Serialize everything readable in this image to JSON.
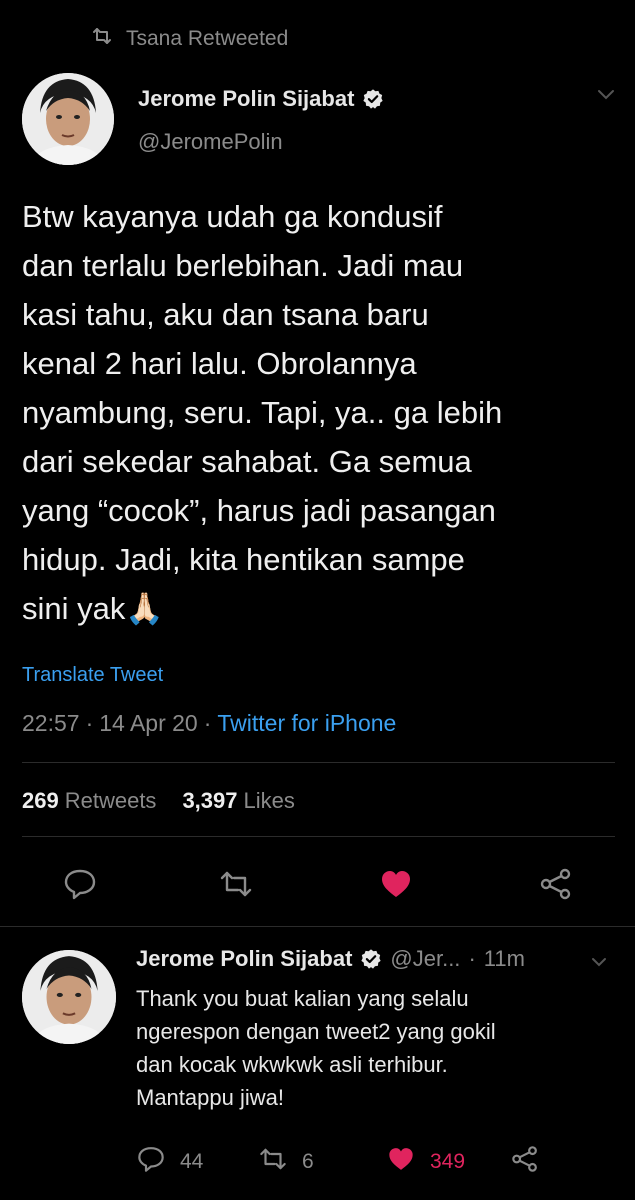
{
  "retweet_context": {
    "text": "Tsana Retweeted",
    "icon": "retweet-icon"
  },
  "main_tweet": {
    "author_name": "Jerome Polin Sijabat",
    "handle": "@JeromePolin",
    "text": "Btw kayanya udah ga kondusif\ndan terlalu berlebihan. Jadi mau\nkasi tahu, aku dan tsana baru\nkenal 2 hari lalu. Obrolannya\nnyambung, seru. Tapi, ya.. ga lebih\ndari sekedar sahabat. Ga semua\nyang “cocok”, harus jadi pasangan\nhidup. Jadi, kita hentikan sampe\nsini yak🙏🏻",
    "translate_label": "Translate Tweet",
    "time": "22:57",
    "date": "14 Apr 20",
    "separator": "·",
    "source": "Twitter for iPhone",
    "retweets_count": "269",
    "retweets_label": "Retweets",
    "likes_count": "3,397",
    "likes_label": "Likes"
  },
  "reply_tweet": {
    "author_name": "Jerome Polin Sijabat",
    "handle": "@Jer...",
    "separator": "·",
    "time_ago": "11m",
    "text": "Thank you buat kalian yang selalu\nngerespon dengan tweet2 yang gokil\ndan kocak wkwkwk asli terhibur.\nMantappu jiwa!",
    "reply_count": "44",
    "retweet_count": "6",
    "like_count": "349"
  },
  "colors": {
    "background": "#000000",
    "link": "#3ba0f0",
    "like": "#e0245e",
    "muted": "#8b8b8b"
  }
}
